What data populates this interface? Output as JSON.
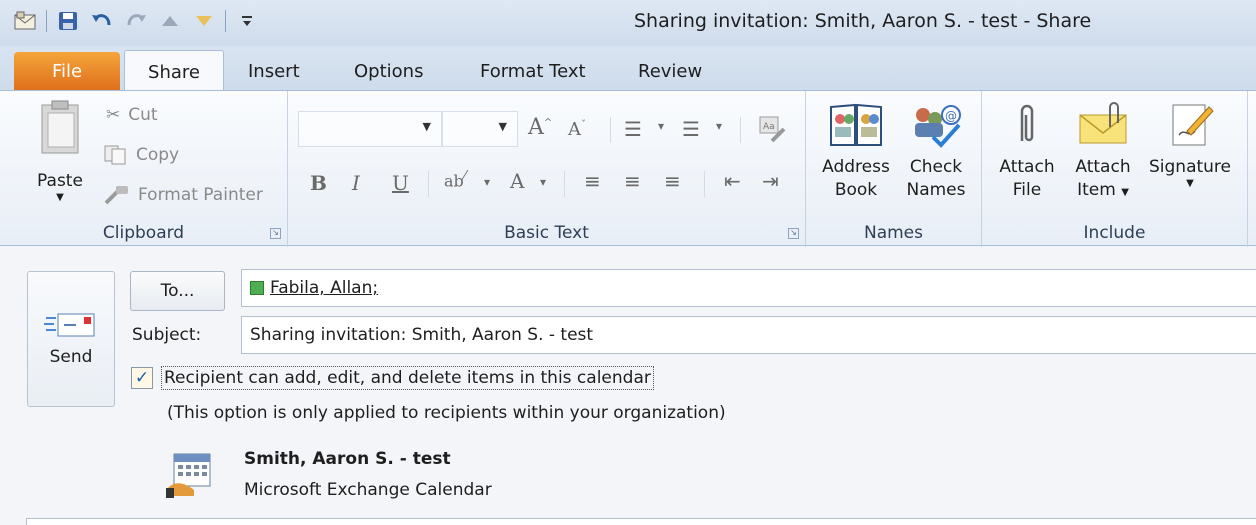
{
  "window": {
    "title": "Sharing invitation: Smith, Aaron S. - test  -  Share"
  },
  "quick_access": [
    {
      "icon": "envelope-icon"
    },
    {
      "icon": "save-icon"
    },
    {
      "icon": "undo-icon"
    },
    {
      "icon": "redo-icon"
    },
    {
      "icon": "up-arrow-icon"
    },
    {
      "icon": "down-arrow-icon"
    },
    {
      "icon": "customize-dropdown-icon"
    }
  ],
  "tabs": [
    {
      "label": "File"
    },
    {
      "label": "Share"
    },
    {
      "label": "Insert"
    },
    {
      "label": "Options"
    },
    {
      "label": "Format Text"
    },
    {
      "label": "Review"
    }
  ],
  "ribbon": {
    "clipboard": {
      "label": "Clipboard",
      "paste": "Paste",
      "cut": "Cut",
      "copy": "Copy",
      "format_painter": "Format Painter"
    },
    "basic_text": {
      "label": "Basic Text",
      "bold": "B",
      "italic": "I",
      "underline": "U"
    },
    "names": {
      "label": "Names",
      "address_book_1": "Address",
      "address_book_2": "Book",
      "check_names_1": "Check",
      "check_names_2": "Names"
    },
    "include": {
      "label": "Include",
      "attach_file_1": "Attach",
      "attach_file_2": "File",
      "attach_item_1": "Attach",
      "attach_item_2": "Item",
      "signature": "Signature"
    }
  },
  "compose": {
    "send": "Send",
    "to_button": "To...",
    "to_value": "Fabila, Allan;",
    "subject_label": "Subject:",
    "subject_value": "Sharing invitation: Smith, Aaron S. - test",
    "checkbox_label": "Recipient can add, edit, and delete items in this calendar",
    "checkbox_checked": true,
    "note": "(This option is only applied to recipients within your organization)",
    "calendar_name": "Smith, Aaron S. - test",
    "calendar_type": "Microsoft Exchange Calendar"
  },
  "colors": {
    "file_tab": "#e0701c",
    "accent": "#2b5fa3"
  }
}
